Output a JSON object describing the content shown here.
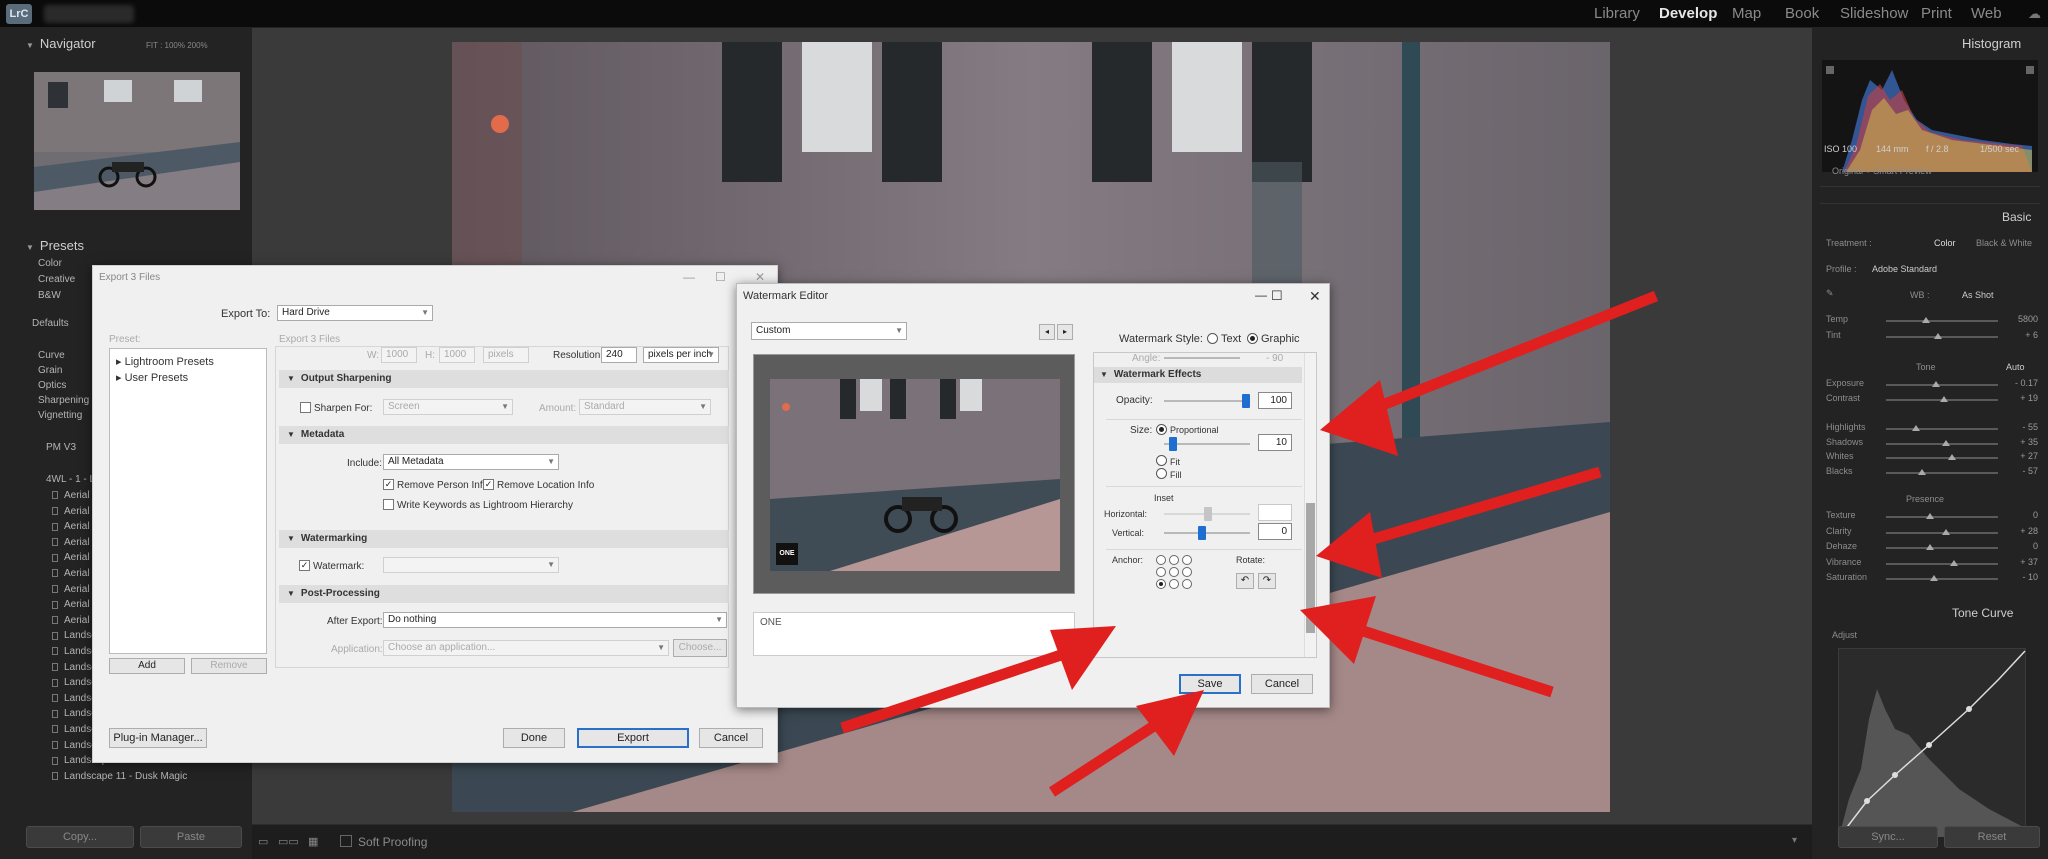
{
  "topbar": {
    "logo": "LrC",
    "modules": [
      "Library",
      "Develop",
      "Map",
      "Book",
      "Slideshow",
      "Print",
      "Web"
    ],
    "active_module": "Develop"
  },
  "left_panel": {
    "navigator_title": "Navigator",
    "zoom_options": "FIT  :  100%  200%",
    "presets_title": "Presets",
    "preset_groups": [
      "Color",
      "Creative",
      "B&W",
      "Defaults",
      "Curve",
      "Grain",
      "Optics",
      "Sharpening",
      "Vignetting",
      "PM V3",
      "4WL - 1 - L"
    ],
    "preset_items": [
      "Aerial 1",
      "Aerial 2",
      "Aerial 3",
      "Aerial 4",
      "Aerial 5",
      "Aerial 6",
      "Aerial 7",
      "Aerial 8",
      "Aerial 9",
      "Landsc",
      "Landsc",
      "Landsc",
      "Landsc",
      "Landsc",
      "Landsc",
      "Landsc",
      "Landscape 9 - Flow",
      "Landscape 10 - Lunar",
      "Landscape 11 - Dusk Magic"
    ],
    "copy_button": "Copy...",
    "paste_button": "Paste"
  },
  "toolbar": {
    "soft_proofing": "Soft Proofing"
  },
  "right_panel": {
    "histogram_title": "Histogram",
    "exif": [
      "ISO 100",
      "144 mm",
      "f / 2.8",
      "1/500 sec"
    ],
    "original_preview": "Original + Smart Preview",
    "basic_title": "Basic",
    "treatment_label": "Treatment :",
    "treatment_color": "Color",
    "treatment_bw": "Black & White",
    "profile_label": "Profile :",
    "profile_value": "Adobe Standard",
    "wb_label": "WB :",
    "wb_value": "As Shot",
    "sliders_wb": [
      {
        "label": "Temp",
        "value": "5800"
      },
      {
        "label": "Tint",
        "value": "+ 6"
      }
    ],
    "tone_label": "Tone",
    "auto_label": "Auto",
    "sliders_tone": [
      {
        "label": "Exposure",
        "value": "- 0.17"
      },
      {
        "label": "Contrast",
        "value": "+ 19"
      },
      {
        "label": "Highlights",
        "value": "- 55"
      },
      {
        "label": "Shadows",
        "value": "+ 35"
      },
      {
        "label": "Whites",
        "value": "+ 27"
      },
      {
        "label": "Blacks",
        "value": "- 57"
      }
    ],
    "presence_label": "Presence",
    "sliders_presence": [
      {
        "label": "Texture",
        "value": "0"
      },
      {
        "label": "Clarity",
        "value": "+ 28"
      },
      {
        "label": "Dehaze",
        "value": "0"
      },
      {
        "label": "Vibrance",
        "value": "+ 37"
      },
      {
        "label": "Saturation",
        "value": "- 10"
      }
    ],
    "tone_curve_title": "Tone Curve",
    "adjust_label": "Adjust",
    "sync_button": "Sync...",
    "reset_button": "Reset"
  },
  "export_dialog": {
    "title": "Export 3 Files",
    "export_to_label": "Export To:",
    "export_to_value": "Hard Drive",
    "preset_label": "Preset:",
    "subtitle": "Export 3 Files",
    "presets": [
      "Lightroom Presets",
      "User Presets"
    ],
    "add_button": "Add",
    "remove_button": "Remove",
    "size_row": {
      "w_label": "W:",
      "w_value": "1000",
      "h_label": "H:",
      "h_value": "1000",
      "unit": "pixels",
      "resolution_label": "Resolution:",
      "resolution_value": "240",
      "resolution_unit": "pixels per inch"
    },
    "output_sharpening": {
      "title": "Output Sharpening",
      "sharpen_for_label": "Sharpen For:",
      "sharpen_for_value": "Screen",
      "amount_label": "Amount:",
      "amount_value": "Standard"
    },
    "metadata": {
      "title": "Metadata",
      "include_label": "Include:",
      "include_value": "All Metadata",
      "remove_person": "Remove Person Info",
      "remove_location": "Remove Location Info",
      "write_keywords": "Write Keywords as Lightroom Hierarchy"
    },
    "watermarking": {
      "title": "Watermarking",
      "watermark_label": "Watermark:",
      "watermark_value": ""
    },
    "post_processing": {
      "title": "Post-Processing",
      "after_export_label": "After Export:",
      "after_export_value": "Do nothing",
      "application_label": "Application:",
      "application_value": "Choose an application...",
      "choose_button": "Choose..."
    },
    "plugin_button": "Plug-in Manager...",
    "done_button": "Done",
    "export_button": "Export",
    "cancel_button": "Cancel"
  },
  "watermark_editor": {
    "title": "Watermark Editor",
    "preset_value": "Custom",
    "style_label": "Watermark Style:",
    "style_text": "Text",
    "style_graphic": "Graphic",
    "angle_label": "Angle:",
    "angle_value": "- 90",
    "effects_title": "Watermark Effects",
    "opacity_label": "Opacity:",
    "opacity_value": "100",
    "opacity_level": 1.0,
    "size_label": "Size:",
    "proportional_label": "Proportional",
    "size_value": "10",
    "size_level": 0.1,
    "fit_label": "Fit",
    "fill_label": "Fill",
    "inset_label": "Inset",
    "horizontal_label": "Horizontal:",
    "horizontal_value": "",
    "vertical_label": "Vertical:",
    "vertical_value": "0",
    "anchor_label": "Anchor:",
    "rotate_label": "Rotate:",
    "rotate_left_icon": "↶",
    "rotate_right_icon": "↷",
    "watermark_text": "ONE",
    "preview_badge": "ONE",
    "save_button": "Save",
    "cancel_button": "Cancel"
  },
  "colors": {
    "arrow": "#e01f1f",
    "primary_focus": "#2a6fc9",
    "slider_knob": "#1f6fd1"
  }
}
